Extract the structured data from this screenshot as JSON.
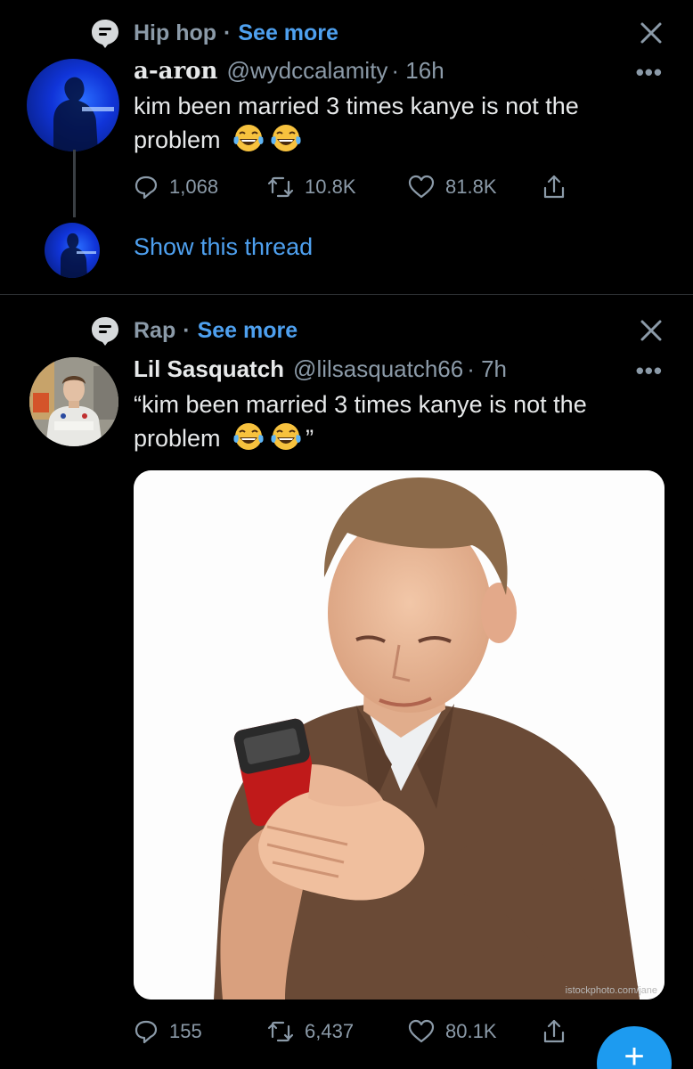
{
  "tweets": [
    {
      "topic": "Hip hop",
      "separator": "·",
      "see_more": "See more",
      "display_name": "a-aron",
      "handle": "@wydccalamity",
      "time": "· 16h",
      "text": "kim been married 3 times kanye is not the problem",
      "emoji": "face-with-tears-of-joy",
      "replies": "1,068",
      "retweets": "10.8K",
      "likes": "81.8K",
      "show_thread": "Show this thread"
    },
    {
      "topic": "Rap",
      "separator": "·",
      "see_more": "See more",
      "display_name": "Lil Sasquatch",
      "handle": "@lilsasquatch66",
      "time": "· 7h",
      "text": "“kim been married 3 times kanye is not the problem",
      "text_suffix": "”",
      "emoji": "face-with-tears-of-joy",
      "replies": "155",
      "retweets": "6,437",
      "likes": "80.1K",
      "media_watermark": "istockphoto.com/jane"
    }
  ],
  "more_dots": "•••",
  "colors": {
    "background": "#000000",
    "text": "#e7e9ea",
    "secondary": "#8b9aa8",
    "link": "#4ea0ef",
    "accent": "#1d9bf0"
  },
  "compose_icon": "plus-icon"
}
